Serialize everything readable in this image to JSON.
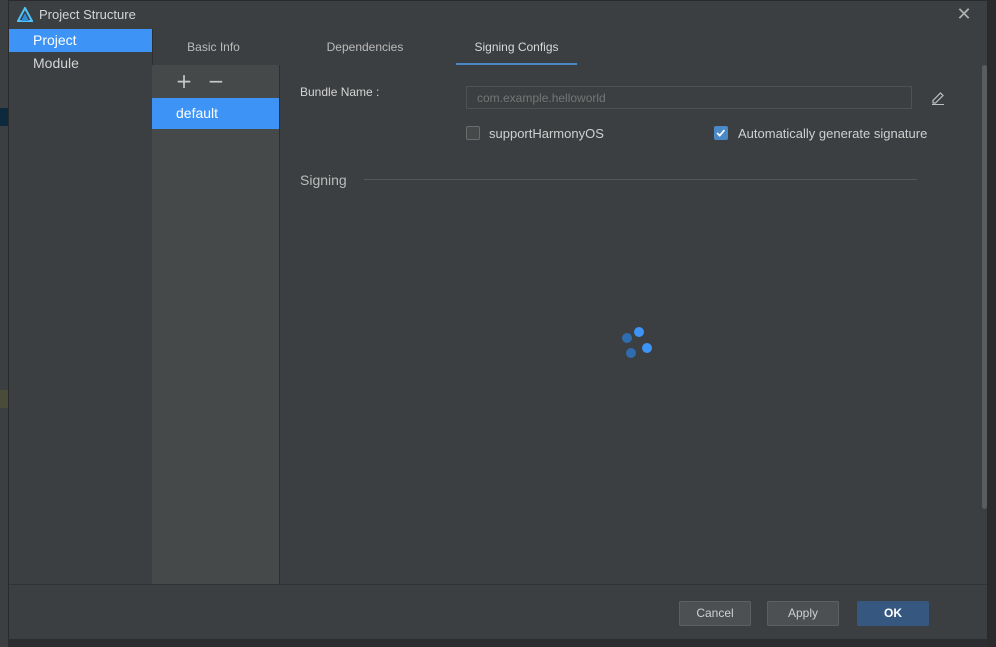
{
  "window": {
    "title": "Project Structure",
    "icons": {
      "app": "harmony-logo-icon",
      "close": "close-icon"
    }
  },
  "sidebar": {
    "items": [
      {
        "label": "Project",
        "selected": true
      },
      {
        "label": "Module",
        "selected": false
      }
    ]
  },
  "tabs": [
    {
      "label": "Basic Info",
      "active": false
    },
    {
      "label": "Dependencies",
      "active": false
    },
    {
      "label": "Signing Configs",
      "active": true
    }
  ],
  "config_list": {
    "toolbar": {
      "add_icon": "plus-icon",
      "remove_icon": "minus-icon"
    },
    "items": [
      {
        "label": "default",
        "selected": true
      }
    ]
  },
  "form": {
    "bundle_name_label": "Bundle Name",
    "bundle_name_placeholder": "com.example.helloworld",
    "bundle_name_value": "",
    "edit_icon": "edit-icon",
    "support_harmony": {
      "label": "supportHarmonyOS",
      "checked": false
    },
    "auto_sign": {
      "label": "Automatically generate signature",
      "checked": true
    },
    "signing_section": "Signing",
    "loading": true
  },
  "footer": {
    "cancel": "Cancel",
    "apply": "Apply",
    "ok": "OK"
  },
  "colors": {
    "accent": "#3d94f6",
    "primary_button": "#365880",
    "dialog_bg": "#3c3f41",
    "list_bg": "#45494a"
  }
}
